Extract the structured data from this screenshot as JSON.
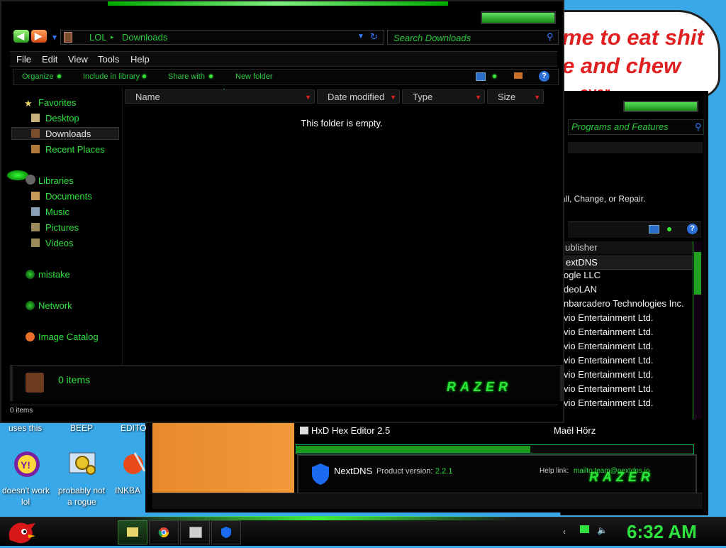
{
  "bubble": {
    "line1": "me to eat shit",
    "line2": "e and chew",
    "line3": "over"
  },
  "bg_window": {
    "search_placeholder": "Programs and Features",
    "description": "all, Change, or Repair.",
    "column_header": "ublisher",
    "selected_publisher": "extDNS",
    "publishers": [
      "ogle LLC",
      "deoLAN",
      "nbarcadero Technologies Inc.",
      "vio Entertainment Ltd.",
      "vio Entertainment Ltd.",
      "vio Entertainment Ltd.",
      "vio Entertainment Ltd.",
      "vio Entertainment Ltd.",
      "vio Entertainment Ltd.",
      "vio Entertainment Ltd."
    ]
  },
  "program_list": {
    "hxd_name": "HxD Hex Editor 2.5",
    "hxd_publisher": "Maël Hörz",
    "selected_name": "NextDNS",
    "product_version_label": "Product version:",
    "product_version": "2.2.1",
    "help_link_label": "Help link:",
    "help_link": "mailto:team@nextdns.io"
  },
  "explorer": {
    "address": {
      "crumb1": "LOL",
      "sep": "▸",
      "crumb2": "Downloads"
    },
    "search_placeholder": "Search Downloads",
    "menu": [
      "File",
      "Edit",
      "View",
      "Tools",
      "Help"
    ],
    "commands": [
      "Organize",
      "Include in library",
      "Share with",
      "New folder"
    ],
    "nav": {
      "favorites": "Favorites",
      "desktop": "Desktop",
      "downloads": "Downloads",
      "recent": "Recent Places",
      "libraries": "Libraries",
      "documents": "Documents",
      "music": "Music",
      "pictures": "Pictures",
      "videos": "Videos",
      "mistake": "mistake",
      "network": "Network",
      "image_catalog": "Image Catalog"
    },
    "columns": [
      "Name",
      "Date modified",
      "Type",
      "Size"
    ],
    "empty_message": "This folder is empty.",
    "details_count": "0 items",
    "razer_logo": "RAZER",
    "status_count": "0 items"
  },
  "desktop": {
    "icons": [
      {
        "label_line1": "doesn't work",
        "label_line2": "lol"
      },
      {
        "label_line1": "probably not",
        "label_line2": "a rogue"
      },
      {
        "label_line1": "INKBA",
        "label_line2": ""
      }
    ],
    "top_labels": [
      "uses this",
      "BEEP",
      "EDITO"
    ]
  },
  "taskbar": {
    "clock": "6:32 AM"
  }
}
